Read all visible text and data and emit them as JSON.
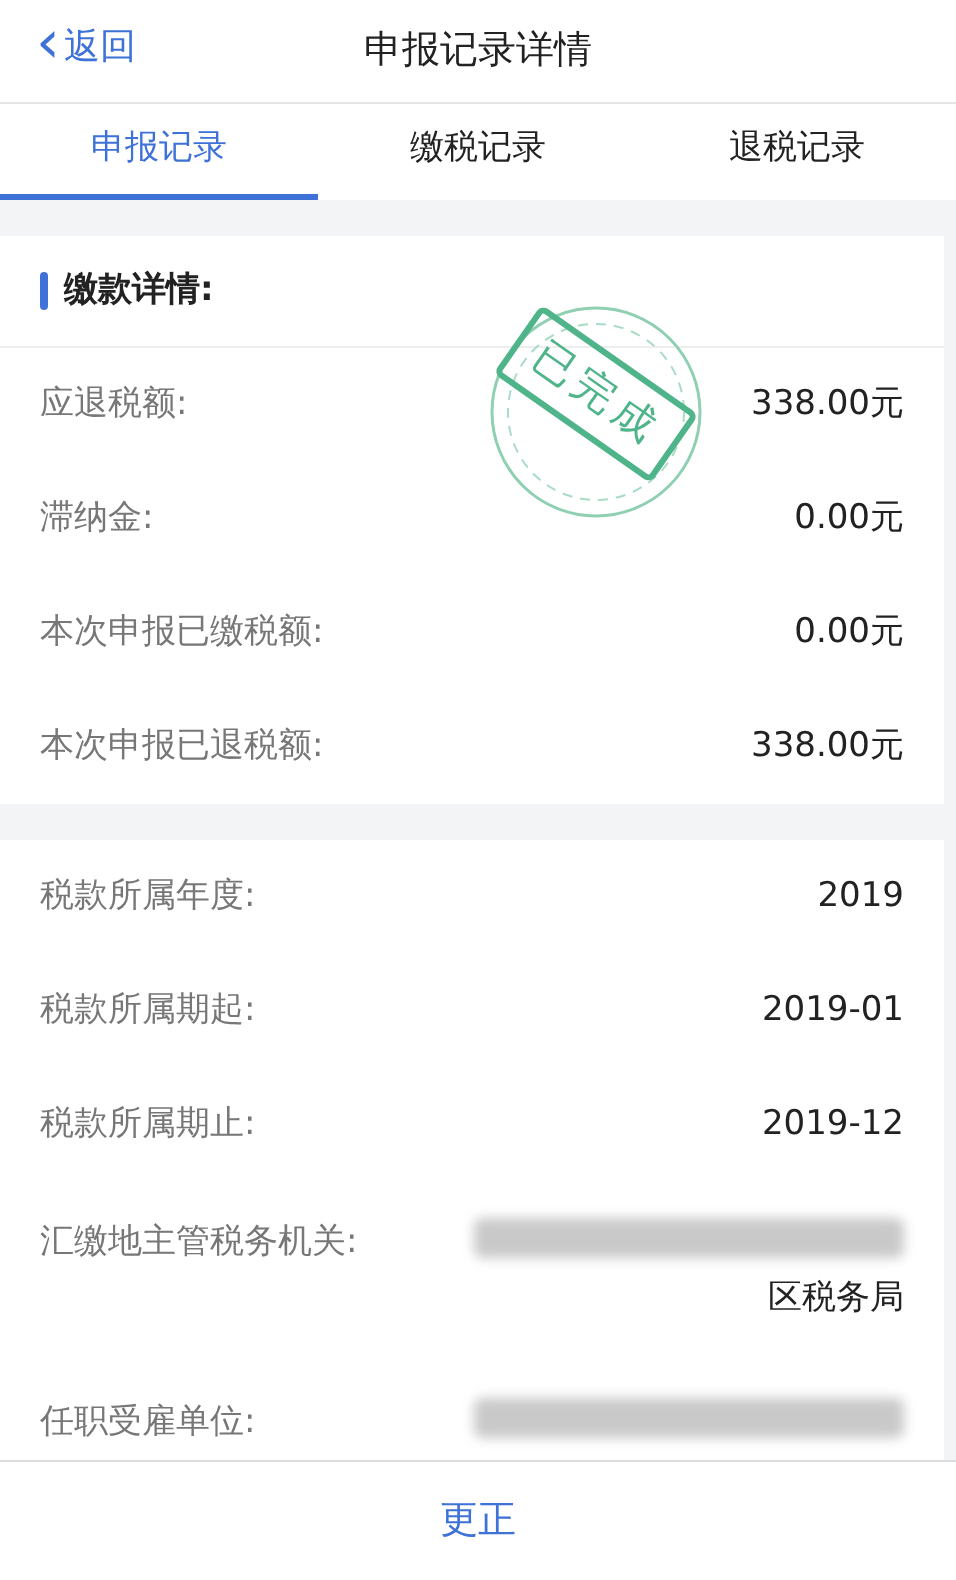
{
  "header": {
    "back": "返回",
    "back_icon": "‹",
    "title": "申报记录详情"
  },
  "tabs": [
    {
      "label": "申报记录",
      "selected": true
    },
    {
      "label": "缴税记录",
      "selected": false
    },
    {
      "label": "退税记录",
      "selected": false
    }
  ],
  "payment_section": {
    "title": "缴款详情:",
    "stamp": "已完成",
    "rows": [
      {
        "label": "应退税额:",
        "value": "338.00元"
      },
      {
        "label": "滞纳金:",
        "value": "0.00元"
      },
      {
        "label": "本次申报已缴税额:",
        "value": "0.00元"
      },
      {
        "label": "本次申报已退税额:",
        "value": "338.00元"
      }
    ]
  },
  "period_section": {
    "rows": [
      {
        "label": "税款所属年度:",
        "value": "2019",
        "kind": "text"
      },
      {
        "label": "税款所属期起:",
        "value": "2019-01",
        "kind": "text"
      },
      {
        "label": "税款所属期止:",
        "value": "2019-12",
        "kind": "text"
      },
      {
        "label": "汇缴地主管税务机关:",
        "value": "区税务局",
        "kind": "redacted"
      },
      {
        "label": "任职受雇单位:",
        "kind": "redacted"
      }
    ]
  },
  "footer": {
    "button": "更正"
  }
}
